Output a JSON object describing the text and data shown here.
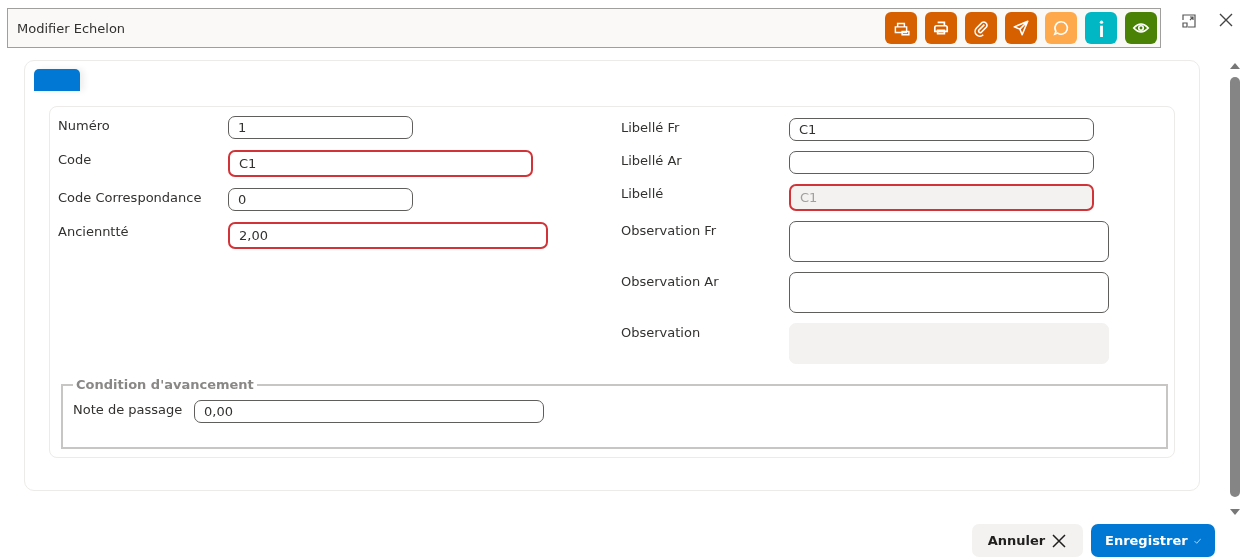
{
  "window": {
    "title": "Modifier Echelon"
  },
  "toolbar": [
    {
      "kind": "print-multi",
      "color": "#d65f00"
    },
    {
      "kind": "print",
      "color": "#d65f00"
    },
    {
      "kind": "attach",
      "color": "#d65f00"
    },
    {
      "kind": "send",
      "color": "#d65f00"
    },
    {
      "kind": "comment",
      "color": "#ffa94d"
    },
    {
      "kind": "info",
      "color": "#00b7c3"
    },
    {
      "kind": "view",
      "color": "#498205"
    }
  ],
  "left_fields": [
    {
      "label": "Numéro",
      "value": "1",
      "invalid": false,
      "disabled": false,
      "multiline": false
    },
    {
      "label": "Code",
      "value": "C1",
      "invalid": true,
      "disabled": false,
      "multiline": false
    },
    {
      "label": "Code Correspondance",
      "value": "0",
      "invalid": false,
      "disabled": false,
      "multiline": false
    },
    {
      "label": "Ancienntté",
      "value": "2,00",
      "invalid": true,
      "disabled": false,
      "multiline": false
    }
  ],
  "right_fields": [
    {
      "label": "Libellé Fr",
      "value": "C1",
      "invalid": false,
      "disabled": false,
      "multiline": false
    },
    {
      "label": "Libellé Ar",
      "invalid": false,
      "disabled": false,
      "multiline": false
    },
    {
      "label": "Libellé",
      "value": "C1",
      "invalid": true,
      "disabled": true,
      "multiline": false
    },
    {
      "label": "Observation Fr",
      "invalid": false,
      "disabled": false,
      "multiline": true
    },
    {
      "label": "Observation Ar",
      "invalid": false,
      "disabled": false,
      "multiline": true
    },
    {
      "label": "Observation",
      "invalid": false,
      "disabled": true,
      "multiline": true
    }
  ],
  "fieldset": {
    "legend": "Condition d'avancement",
    "fields": [
      {
        "label": "Note de passage",
        "value": "0,00",
        "invalid": false,
        "disabled": false,
        "multiline": false
      }
    ]
  },
  "buttons": [
    {
      "label": "Annuler",
      "kind": "cancel"
    },
    {
      "label": "Enregistrer",
      "kind": "save"
    }
  ]
}
